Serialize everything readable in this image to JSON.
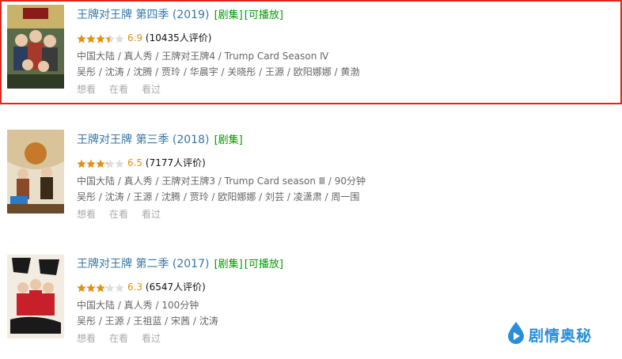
{
  "results": [
    {
      "title": "王牌对王牌 第四季 (2019)",
      "tags": [
        "[剧集]",
        "[可播放]"
      ],
      "rating_fraction": 0.69,
      "score": "6.9",
      "votes": "(10435人评价)",
      "meta": "中国大陆 / 真人秀 / 王牌对王牌4 / Trump Card Season Ⅳ",
      "cast": "吴彤 / 沈涛 / 沈腾 / 贾玲 / 华晨宇 / 关晓彤 / 王源 / 欧阳娜娜 / 黄渤",
      "actions": [
        "想看",
        "在看",
        "看过"
      ],
      "highlighted": true
    },
    {
      "title": "王牌对王牌 第三季 (2018)",
      "tags": [
        "[剧集]"
      ],
      "rating_fraction": 0.65,
      "score": "6.5",
      "votes": "(7177人评价)",
      "meta": "中国大陆 / 真人秀 / 王牌对王牌3 / Trump Card season Ⅲ / 90分钟",
      "cast": "吴彤 / 沈涛 / 王源 / 沈腾 / 贾玲 / 欧阳娜娜 / 刘芸 / 凌潇肃 / 周一围",
      "actions": [
        "想看",
        "在看",
        "看过"
      ],
      "highlighted": false
    },
    {
      "title": "王牌对王牌 第二季 (2017)",
      "tags": [
        "[剧集]",
        "[可播放]"
      ],
      "rating_fraction": 0.63,
      "score": "6.3",
      "votes": "(6547人评价)",
      "meta": "中国大陆 / 真人秀 / 100分钟",
      "cast": "吴彤 / 王源 / 王祖蓝 / 宋茜 / 沈涛",
      "actions": [
        "想看",
        "在看",
        "看过"
      ],
      "highlighted": false
    }
  ],
  "watermark": {
    "text": "剧情奥秘",
    "icon": "play-drop-icon"
  },
  "colors": {
    "link": "#3377aa",
    "tag": "#009900",
    "score": "#e09015",
    "highlight": "#e1251b",
    "watermark": "#2a8fd8"
  }
}
